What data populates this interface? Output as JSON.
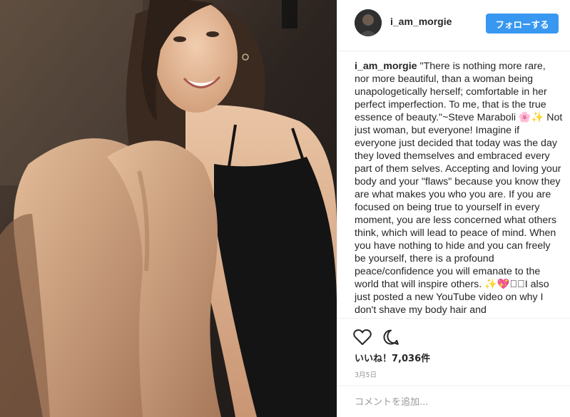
{
  "photo": {
    "alt_icon": "photo"
  },
  "header": {
    "username": "i_am_morgie",
    "follow_label": "フォローする",
    "follow_color": "#3897f0"
  },
  "caption": {
    "username": "i_am_morgie",
    "text": "\"There is nothing more rare, nor more beautiful, than a woman being unapologetically herself; comfortable in her perfect imperfection. To me, that is the true essence of beauty.\"~Steve Maraboli 🌸✨ Not just woman, but everyone! Imagine if everyone just decided that today was the day they loved themselves and embraced every part of them selves. Accepting and loving your body and your \"flaws\" because you know they are what makes you who you are. If you are focused on being true to yourself in every moment, you are less concerned what others think, which will lead to peace of mind. When you have nothing to hide and you can freely be yourself, there is a profound peace/confidence you will emanate to the world that will inspire others. ✨💖☐🏽I also just posted a new YouTube video on why I don't shave my body hair and"
  },
  "actions": {
    "like_icon": "heart-outline",
    "comment_icon": "speech-bubble-outline",
    "likes_text": "いいね！7,036件",
    "date_text": "3月5日"
  },
  "comment": {
    "placeholder": "コメントを追加..."
  }
}
